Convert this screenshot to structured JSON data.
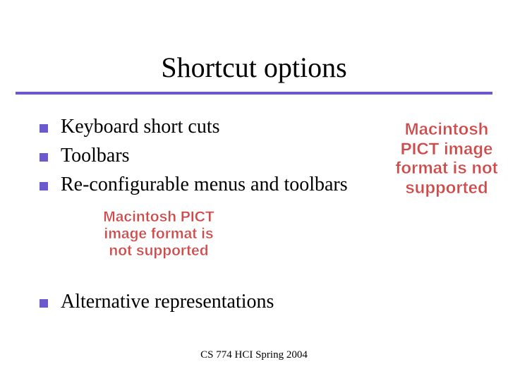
{
  "title": "Shortcut options",
  "bullets": [
    "Keyboard short cuts",
    "Toolbars",
    "Re-configurable menus and toolbars"
  ],
  "alt_bullet": "Alternative representations",
  "missing_image_text": "Macintosh PICT image format is not supported",
  "footer": "CS 774 HCI Spring 2004",
  "colors": {
    "accent": "#6a5acd",
    "error": "#d04a4a"
  }
}
